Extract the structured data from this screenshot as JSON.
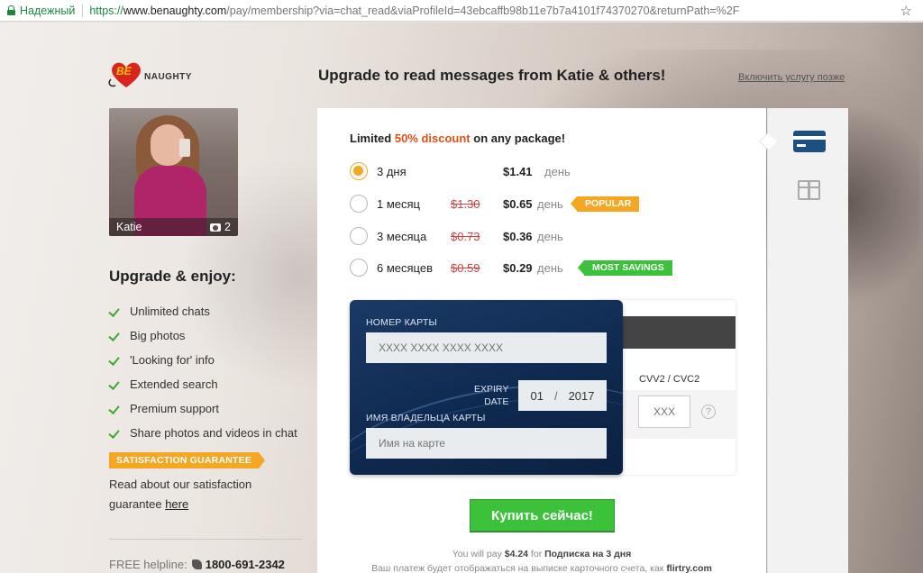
{
  "browser": {
    "secure_label": "Надежный",
    "url_proto": "https://",
    "url_host": "www.benaughty.com",
    "url_rest": "/pay/membership?via=chat_read&viaProfileId=43ebcaffb98b11e7b7a4101f74370270&returnPath=%2F"
  },
  "logo": {
    "text": "NAUGHTY",
    "mark": "BE"
  },
  "profile": {
    "name": "Katie",
    "photo_count": "2"
  },
  "header": {
    "title": "Upgrade to read messages from Katie & others!",
    "later_link": "Включить услугу позже"
  },
  "enjoy": {
    "title": "Upgrade & enjoy:",
    "features": [
      "Unlimited chats",
      "Big photos",
      "'Looking for' info",
      "Extended search",
      "Premium support",
      "Share photos and videos in chat"
    ],
    "guarantee_badge": "SATISFACTION GUARANTEE",
    "guarantee_text": "Read about our satisfaction guarantee",
    "guarantee_link": "here"
  },
  "helpline": {
    "label": "FREE helpline:",
    "number": "1800-691-2342"
  },
  "offer": {
    "prefix": "Limited ",
    "highlight": "50% discount",
    "suffix": " on any package!"
  },
  "plans": [
    {
      "name": "3 дня",
      "old_price": "",
      "price": "$1.41",
      "per": "день",
      "badge": "",
      "selected": true
    },
    {
      "name": "1 месяц",
      "old_price": "$1.30",
      "price": "$0.65",
      "per": "день",
      "badge": "POPULAR",
      "selected": false
    },
    {
      "name": "3 месяца",
      "old_price": "$0.73",
      "price": "$0.36",
      "per": "день",
      "badge": "",
      "selected": false
    },
    {
      "name": "6 месяцев",
      "old_price": "$0.59",
      "price": "$0.29",
      "per": "день",
      "badge": "MOST SAVINGS",
      "selected": false
    }
  ],
  "card": {
    "number_label": "НОМЕР КАРТЫ",
    "number_placeholder": "XXXX XXXX XXXX XXXX",
    "expiry_label_1": "EXPIRY",
    "expiry_label_2": "DATE",
    "expiry_month": "01",
    "expiry_year": "2017",
    "holder_label": "ИМЯ ВЛАДЕЛЬЦА КАРТЫ",
    "holder_placeholder": "Имя на карте",
    "cvv_label": "CVV2 / CVC2",
    "cvv_placeholder": "XXX"
  },
  "buy_button": "Купить сейчас!",
  "payment": {
    "note_prefix": "You will pay ",
    "amount": "$4.24",
    "note_mid": " for ",
    "subscription": "Подписка на 3 дня",
    "statement_prefix": "Ваш платеж будет отображаться на выписке карточного счета, как ",
    "statement_name": "flirtry.com"
  },
  "colors": {
    "accent_orange": "#f5a623",
    "accent_green": "#3cc13b",
    "discount_red": "#e04e16",
    "card_blue": "#1a3a66"
  },
  "icons": [
    "lock-icon",
    "star-icon",
    "camera-icon",
    "check-icon",
    "phone-icon",
    "credit-card-icon",
    "gift-icon",
    "help-icon"
  ]
}
